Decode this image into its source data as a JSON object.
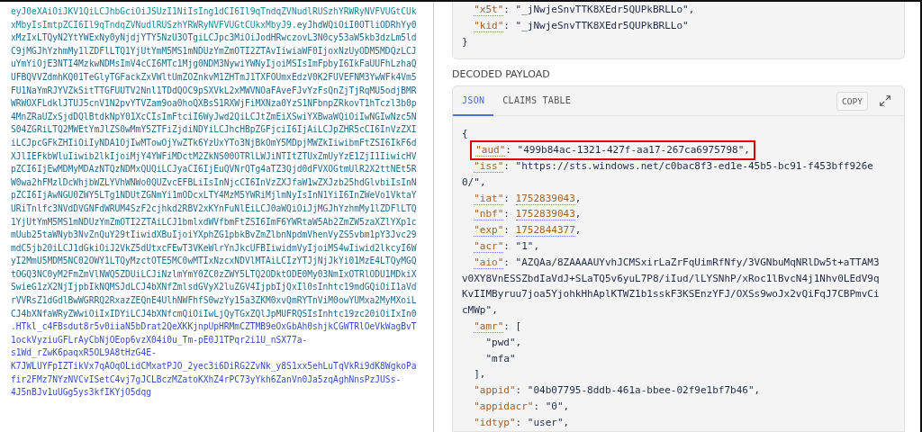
{
  "encoded_token": {
    "lines": [
      {
        "segments": [
          {
            "kind": "header",
            "text": "eyJ0eXAiOiJKV1QiLCJhbGciOiJSUzI1NiIsIng1dCI6Il9qTndqZVNudlRUSzhYRWRyNVFVUGtCUk"
          }
        ]
      },
      {
        "segments": [
          {
            "kind": "header",
            "text": "xMbyIsImtpZCI6Il9qTndqZVNudlRUSzhYRWRyNVFVUGtCUkxMbyJ9"
          },
          {
            "kind": "payload",
            "text": ".eyJhdWQiOiI0OTliODRhYy0"
          }
        ]
      },
      {
        "segments": [
          {
            "kind": "payload",
            "text": "xMzIxLTQyN2YtYWExNy0yNjdjYTY5NzU3OTgiLCJpc3MiOiJodHRwczovL3N0cy53aW5kb3dzLm5ld"
          }
        ]
      },
      {
        "segments": [
          {
            "kind": "payload",
            "text": "C9jMGJhYzhmMy1lZDFlLTQ1YjUtYmM5MS1mNDUzYmZmOTI2ZTAvIiwiaWF0IjoxNzUyODM5MDQzLCJ"
          }
        ]
      },
      {
        "segments": [
          {
            "kind": "payload",
            "text": "uYmYiOjE3NTI4MzkwNDMsImV4cCI6MTc1Mjg0NDM3NywiYWNyIjoiMSIsImFpbyI6IkFaUUFhLzhaQ"
          }
        ]
      },
      {
        "segments": [
          {
            "kind": "payload",
            "text": "UFBQVVZdmhKQ01TeGlyTGFackZxVWltUmZOZnkvM1ZHTmJ1TXFOUmxEdzV0K2FUVEFNM3YwWFk4Vm5"
          }
        ]
      },
      {
        "segments": [
          {
            "kind": "payload",
            "text": "FU1NaYmRJYVZkSitTTGFUUTV2Nnl1TDdQOC9pSXVkL2xMWVNOaFAveFJvYzFsQnZjTjRqMU5odjBMR"
          }
        ]
      },
      {
        "segments": [
          {
            "kind": "payload",
            "text": "WRWOXFLdklJTUJ5cnV1N2pvYTVZam9oa0hoQXBsS1RXWjFiMXNza0YzS1NFbnpZRkovT1hTczl3b0p"
          }
        ]
      },
      {
        "segments": [
          {
            "kind": "payload",
            "text": "4MnZRaUZxSjdDQlBtdkNpY01XcCIsImFtciI6WyJwd2QiLCJtZmEiXSwiYXBwaWQiOiIwNGIwNzc5N"
          }
        ]
      },
      {
        "segments": [
          {
            "kind": "payload",
            "text": "S04ZGRiLTQ2MWEtYmJlZS0wMmY5ZTFiZjdiNDYiLCJhcHBpZGFjciI6IjAiLCJpZHR5cCI6InVzZXI"
          }
        ]
      },
      {
        "segments": [
          {
            "kind": "payload",
            "text": "iLCJpcGFkZHIiOiIyNDA1OjIwMTowOjYwZTk6YzUxYTo3NjBkOmY5MDpjMWZkIiwibmFtZSI6IkF6d"
          }
        ]
      },
      {
        "segments": [
          {
            "kind": "payload",
            "text": "XJlIEFkbWluIiwib2lkIjoiMjY4YWFiMDctM2ZkNS00OTRlLWJiNTItZTUxZmUyYzE1ZjI1IiwicHV"
          }
        ]
      },
      {
        "segments": [
          {
            "kind": "payload",
            "text": "pZCI6IjEwMDMyMDAzNTQzNDMxQUQiLCJyaCI6IjEuQVNrQTg4aTZ3Qjd0dFVXOGtmUlR2X2ttNEt5R"
          }
        ]
      },
      {
        "segments": [
          {
            "kind": "payload",
            "text": "W0wa2hFMzlDcWhjbWZLYVhWNWo0QUZvcEFBLiIsInNjcCI6InVzZXJfaW1wZXJzb25hdGlvbiIsInN"
          }
        ]
      },
      {
        "segments": [
          {
            "kind": "payload",
            "text": "pZCI6IjAwNGU0ZWY5LTg1NDUtZGNmYi1mODcxLTY4MzM5YWRiMjlmNyIsInN1YiI6InZWeVo1VktaY"
          }
        ]
      },
      {
        "segments": [
          {
            "kind": "payload",
            "text": "URiTnlfc3NVdDVGNFdWRUM4SzF2cjhkd2RBV2xKYnFuNlEiLCJ0aWQiOiJjMGJhYzhmMy1lZDFlLTQ"
          }
        ]
      },
      {
        "segments": [
          {
            "kind": "payload",
            "text": "1YjUtYmM5MS1mNDUzYmZmOTI2ZTAiLCJ1bmlxdWVfbmFtZSI6ImF6YWRtaW5Ab2ZmZW5zaXZlYXp1c"
          }
        ]
      },
      {
        "segments": [
          {
            "kind": "payload",
            "text": "mUub25taWNyb3NvZnQuY29tIiwidXBuIjoiYXphZG1pbkBvZmZlbnNpdmVhenVyZS5vbm1pY3Jvc29"
          }
        ]
      },
      {
        "segments": [
          {
            "kind": "payload",
            "text": "mdC5jb20iLCJ1dGkiOiJ2VkZ5dUtxcFEwT3VKeWlrYnJkcUFBIiwidmVyIjoiMS4wIiwid2lkcyI6W"
          }
        ]
      },
      {
        "segments": [
          {
            "kind": "payload",
            "text": "yI2MmU5MDM5NC02OWY1LTQyMzctOTE5MC0wMTIxNzcxNDVlMTAiLCIzYTJjNjJkYi01MzE4LTQyMGQ"
          }
        ]
      },
      {
        "segments": [
          {
            "kind": "payload",
            "text": "tOGQ3NC0yM2FmZmVlNWQ5ZDUiLCJiNzlmYmY0ZC0zZWY5LTQ2ODktODE0My03NmIxOTRlODU1MDkiX"
          }
        ]
      },
      {
        "segments": [
          {
            "kind": "payload",
            "text": "SwieG1zX2NjIjpbIkNQMSJdLCJ4bXNfZmlsdGVyX2luZGV4IjpbIjQxIl0sInhtc19mdGQiOiI1aVd"
          }
        ]
      },
      {
        "segments": [
          {
            "kind": "payload",
            "text": "rVVRsZ1dGdlBwWGRRQ2RxazZEQnE4UlhNWFhfS0wzYy15a3ZKM0xvQmRYTnViM0owYUMxa2MyMXoiL"
          }
        ]
      },
      {
        "segments": [
          {
            "kind": "payload",
            "text": "CJ4bXNfaWRyZWwiOiIxIDYiLCJ4bXNfcmQiOiIwLjQyTGxZQlJpMUFRQSIsInhtc19zc20iOiIxIn0"
          }
        ]
      },
      {
        "segments": [
          {
            "kind": "signature",
            "text": ".HTkl_c4FBsdut8r5v0iiaN5bDrat2QeXKKjnpUpHRMmCZTMB9eOxGbAh0shjkCGWTRlOeVkWagBvT"
          }
        ]
      },
      {
        "segments": [
          {
            "kind": "signature",
            "text": "1ockVyziuGFLrAyCbNjOEop6vzX04i0u_Tm-pE0J1TPqr2i1U_nSX77a-"
          }
        ]
      },
      {
        "segments": [
          {
            "kind": "signature",
            "text": "s1Wd_rZwK6paqxR5OL9A8tHzG4E-"
          }
        ]
      },
      {
        "segments": [
          {
            "kind": "signature",
            "text": "K7JWLUYFpIZTikVx7qAOqOLidCMxatPJO_2yec3i6DiRG2ZvNk_y8S1xx5ehLuTqVkRi9dK8WgkoPa"
          }
        ]
      },
      {
        "segments": [
          {
            "kind": "signature",
            "text": "fir2FMz7NYzNVCvISetC4vj7gJCLBczMZatoKXhZ4rPC73yYkh6ZanVn0Ja5zqAghNnsPzJUSs-"
          }
        ]
      },
      {
        "segments": [
          {
            "kind": "signature",
            "text": "4J5nBJv1uUGg5ys3kfIKYjO5dqg"
          }
        ]
      }
    ]
  },
  "decoded_header": {
    "entries": [
      {
        "key": "\"x5t\"",
        "key_tooltip": true,
        "sep": ": ",
        "kind": "string",
        "value_lines": [
          "\"_jNwjeSnvTTK8XEdr5QUPkBRLLo\""
        ],
        "trail": ","
      },
      {
        "key": "\"kid\"",
        "key_tooltip": true,
        "sep": ": ",
        "kind": "string",
        "value_lines": [
          "\"_jNwjeSnvTTK8XEdr5QUPkBRLLo\""
        ]
      }
    ],
    "close": "}"
  },
  "decoded_payload": {
    "title": "DECODED PAYLOAD",
    "tabs": [
      {
        "label": "JSON",
        "selected": true
      },
      {
        "label": "CLAIMS TABLE",
        "selected": false
      }
    ],
    "copy_button": "COPY",
    "json": {
      "open": "{",
      "entries": [
        {
          "key": "\"aud\"",
          "key_tooltip": true,
          "sep": ": ",
          "kind": "string",
          "value_lines": [
            "\"499b84ac-1321-427f-aa17-267ca6975798\""
          ],
          "trail": ",",
          "highlighted": true
        },
        {
          "key": "\"iss\"",
          "key_tooltip": true,
          "sep": ": ",
          "kind": "string",
          "value_lines": [
            "\"https://sts.windows.net/c0bac8f3-ed1e-45b5-bc91-f453bff926e",
            "0/\""
          ],
          "trail": ","
        },
        {
          "key": "\"iat\"",
          "key_tooltip": true,
          "sep": ": ",
          "kind": "number",
          "value_tooltip": true,
          "value_lines": [
            "1752839043"
          ],
          "trail": ","
        },
        {
          "key": "\"nbf\"",
          "key_tooltip": true,
          "sep": ": ",
          "kind": "number",
          "value_tooltip": true,
          "value_lines": [
            "1752839043"
          ],
          "trail": ","
        },
        {
          "key": "\"exp\"",
          "key_tooltip": true,
          "sep": ": ",
          "kind": "number",
          "value_tooltip": true,
          "value_lines": [
            "1752844377"
          ],
          "trail": ","
        },
        {
          "key": "\"acr\"",
          "key_tooltip": true,
          "sep": ": ",
          "kind": "string",
          "value_lines": [
            "\"1\""
          ],
          "trail": ","
        },
        {
          "key": "\"aio\"",
          "key_tooltip": true,
          "sep": ": ",
          "kind": "string",
          "value_lines": [
            "\"AZQAa/8ZAAAAUYvhJCMSxirLaZrFqUimRfNfy/3VGNbuMqNRlDw5t+aTTAM3",
            "v0XY8VnESSZbdIaVdJ+SLaTQ5v6yuL7P8/iIud/lLYSNhP/xRoc1lBvcN4j1Nhv0LEdV9q",
            "KvIIMByruu7joa5YjohkHhAplKTWZ1b1sskF3KSEnzYFJ/OXSs9woJx2vQiFqJ7CBPmvCi",
            "cMWp\""
          ],
          "trail": ","
        },
        {
          "key": "\"amr\"",
          "key_tooltip": true,
          "sep": ": ",
          "kind": "array",
          "open": "[",
          "items": [
            {
              "text": "\"pwd\"",
              "trail": ","
            },
            {
              "text": "\"mfa\""
            }
          ],
          "close": "]",
          "trail": ","
        },
        {
          "key": "\"appid\"",
          "key_tooltip": false,
          "sep": ": ",
          "kind": "string",
          "value_lines": [
            "\"04b07795-8ddb-461a-bbee-02f9e1bf7b46\""
          ],
          "trail": ","
        },
        {
          "key": "\"appidacr\"",
          "key_tooltip": false,
          "sep": ": ",
          "kind": "string",
          "value_lines": [
            "\"0\""
          ],
          "trail": ","
        },
        {
          "key": "\"idtyp\"",
          "key_tooltip": false,
          "sep": ": ",
          "kind": "string",
          "value_lines": [
            "\"user\""
          ],
          "trail": ","
        }
      ]
    }
  }
}
